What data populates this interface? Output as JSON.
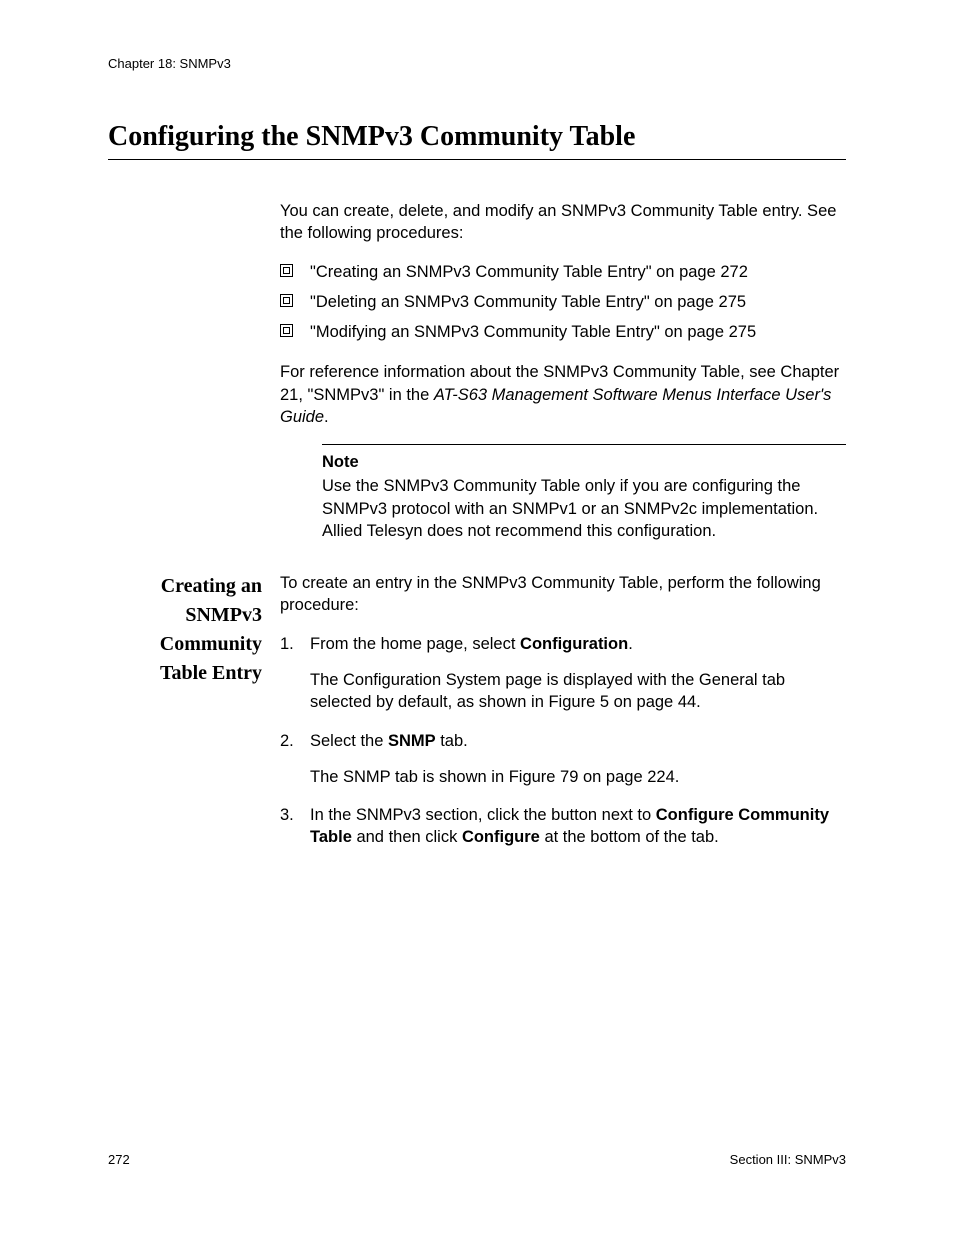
{
  "header": {
    "chapter": "Chapter 18: SNMPv3"
  },
  "title": "Configuring the SNMPv3 Community Table",
  "intro1": "You can create, delete, and modify an SNMPv3 Community Table entry. See the following procedures:",
  "bullets": [
    "\"Creating an SNMPv3 Community Table Entry\" on page 272",
    "\"Deleting an SNMPv3 Community Table Entry\" on page 275",
    "\"Modifying an SNMPv3 Community Table Entry\" on page 275"
  ],
  "intro2_pre": "For reference information about the SNMPv3 Community Table, see Chapter 21, \"SNMPv3\" in the ",
  "intro2_italic": "AT-S63 Management Software Menus Interface User's Guide",
  "intro2_post": ".",
  "note": {
    "title": "Note",
    "body": "Use the SNMPv3 Community Table only if you are configuring the SNMPv3 protocol with an SNMPv1 or an SNMPv2c implementation. Allied Telesyn does not recommend this configuration."
  },
  "sideHeading": {
    "l1": "Creating an",
    "l2": "SNMPv3",
    "l3": "Community",
    "l4": "Table Entry"
  },
  "proc_intro": "To create an entry in the SNMPv3 Community Table, perform the following procedure:",
  "steps": {
    "s1": {
      "num": "1.",
      "pre": "From the home page, select ",
      "bold": "Configuration",
      "post": ".",
      "note": "The Configuration System page is displayed with the General tab selected by default, as shown in Figure 5 on page 44."
    },
    "s2": {
      "num": "2.",
      "pre": "Select the ",
      "bold": "SNMP",
      "post": " tab.",
      "note": "The SNMP tab is shown in Figure 79 on page 224."
    },
    "s3": {
      "num": "3.",
      "pre": "In the SNMPv3 section, click the button next to ",
      "bold1": "Configure Community Table",
      "mid": " and then click ",
      "bold2": "Configure",
      "post": " at the bottom of the tab."
    }
  },
  "footer": {
    "page": "272",
    "section": "Section III: SNMPv3"
  }
}
